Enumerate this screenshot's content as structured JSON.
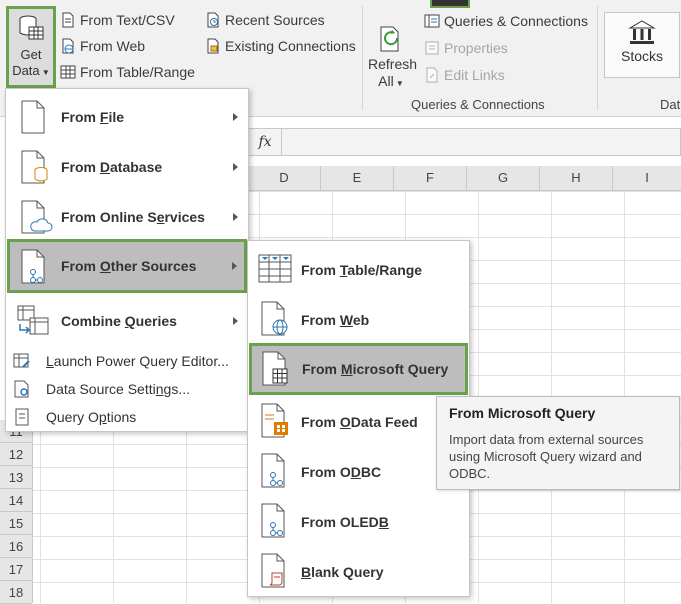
{
  "ribbon": {
    "get_data_line1": "Get",
    "get_data_line2": "Data",
    "from_text_csv": "From Text/CSV",
    "from_web": "From Web",
    "from_table_range": "From Table/Range",
    "recent_sources": "Recent Sources",
    "existing_connections": "Existing Connections",
    "refresh_all_line1": "Refresh",
    "refresh_all_line2": "All",
    "queries_connections": "Queries & Connections",
    "properties": "Properties",
    "edit_links": "Edit Links",
    "group_queries_label": "Queries & Connections",
    "stocks": "Stocks",
    "group_data_types_label": "Dat"
  },
  "formula_bar": {
    "fx": "fx"
  },
  "columns": [
    "D",
    "E",
    "F",
    "G",
    "H",
    "I"
  ],
  "rows": [
    "11",
    "12",
    "13",
    "14",
    "15",
    "16",
    "17",
    "18"
  ],
  "menu": {
    "items": [
      {
        "pre": "From ",
        "key": "F",
        "post": "ile"
      },
      {
        "pre": "From ",
        "key": "D",
        "post": "atabase"
      },
      {
        "pre": "From Online S",
        "key": "e",
        "post": "rvices"
      },
      {
        "pre": "From ",
        "key": "O",
        "post": "ther Sources"
      },
      {
        "pre": "Combine ",
        "key": "Q",
        "post": "ueries"
      }
    ],
    "commands": [
      {
        "pre": "",
        "key": "L",
        "post": "aunch Power Query Editor..."
      },
      {
        "pre": "Data Source Setti",
        "key": "n",
        "post": "gs..."
      },
      {
        "pre": "Query O",
        "key": "p",
        "post": "tions"
      }
    ]
  },
  "submenu": {
    "items": [
      {
        "pre": "From ",
        "key": "T",
        "post": "able/Range"
      },
      {
        "pre": "From ",
        "key": "W",
        "post": "eb"
      },
      {
        "pre": "From ",
        "key": "M",
        "post": "icrosoft Query"
      },
      {
        "pre": "From ",
        "key": "O",
        "post": "Data Feed"
      },
      {
        "pre": "From O",
        "key": "D",
        "post": "BC"
      },
      {
        "pre": "From OLED",
        "key": "B",
        "post": ""
      },
      {
        "pre": "",
        "key": "B",
        "post": "lank Query"
      }
    ]
  },
  "tooltip": {
    "title": "From Microsoft Query",
    "description": "Import data from external sources using Microsoft Query wizard and ODBC."
  },
  "colors": {
    "highlight_border": "#6aa14b",
    "highlight_fill": "#bdbdbd",
    "accent_blue": "#2e75b6",
    "accent_orange": "#e07b00"
  }
}
